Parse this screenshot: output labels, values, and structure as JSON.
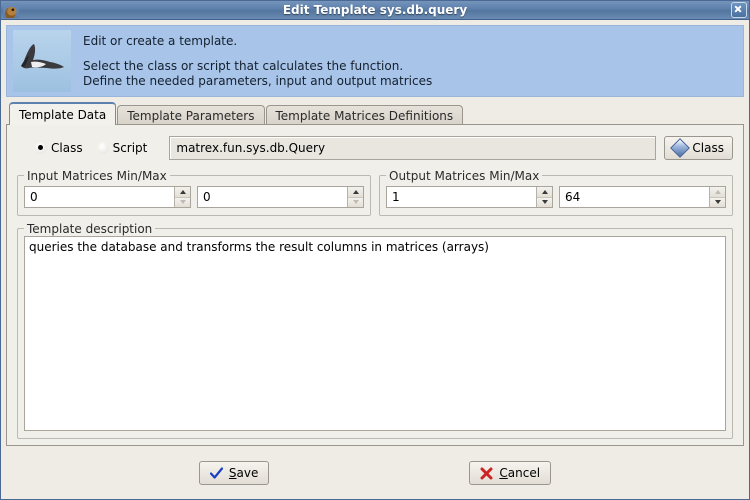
{
  "window": {
    "title": "Edit Template sys.db.query",
    "icon": "bird-head-icon",
    "close_label": "×"
  },
  "banner": {
    "image": "flying-hawk-photo",
    "line1": "Edit or create a template.",
    "line2": "Select the class or script that calculates the function.",
    "line3": "Define the needed parameters, input and output matrices",
    "bg_color": "#a8c4e8"
  },
  "tabs": [
    {
      "label": "Template Data",
      "active": true
    },
    {
      "label": "Template Parameters",
      "active": false
    },
    {
      "label": "Template Matrices Definitions",
      "active": false
    }
  ],
  "source_type": {
    "class_label": "Class",
    "script_label": "Script",
    "selected": "Class"
  },
  "class_field": {
    "value": "matrex.fun.sys.db.Query",
    "placeholder": ""
  },
  "class_button": {
    "label": "Class",
    "icon": "blue-diamond-icon"
  },
  "input_matrices": {
    "title": "Input Matrices Min/Max",
    "min_value": "0",
    "max_value": "0"
  },
  "output_matrices": {
    "title": "Output Matrices Min/Max",
    "min_value": "1",
    "max_value": "64"
  },
  "description": {
    "title": "Template description",
    "value": "queries the database and transforms the result columns in matrices (arrays)"
  },
  "footer": {
    "save": {
      "label": "ave",
      "mnemonic": "S",
      "icon": "blue-check-icon"
    },
    "cancel": {
      "label": "ancel",
      "mnemonic": "C",
      "icon": "red-x-icon"
    }
  },
  "colors": {
    "titlebar": "#5c7faa",
    "banner": "#a8c4e8",
    "panel": "#f1efe9",
    "accent_blue": "#4a6ea8",
    "cancel_red": "#cc2222"
  }
}
